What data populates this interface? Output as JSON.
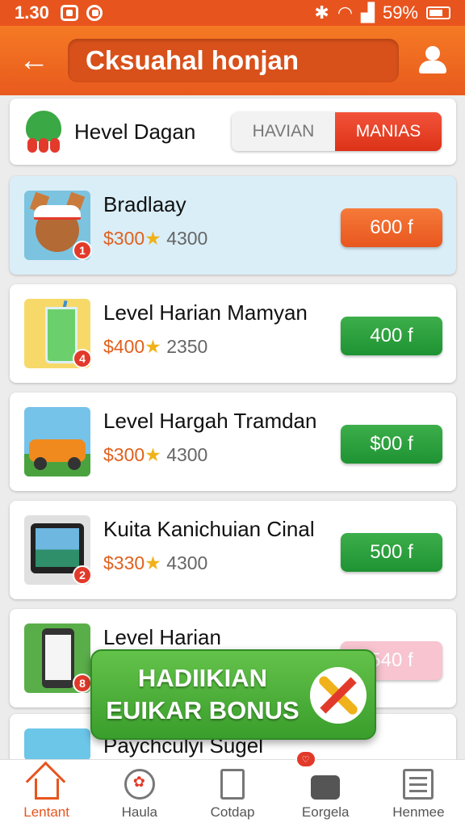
{
  "status_bar": {
    "time": "1.30",
    "battery": "59%"
  },
  "header": {
    "title": "Cksuahal honjan"
  },
  "filter": {
    "title": "Hevel Dagan",
    "tabs": [
      {
        "label": "HAVIAN",
        "active": false
      },
      {
        "label": "MANIAS",
        "active": true
      }
    ]
  },
  "items": [
    {
      "title": "Bradlaay",
      "price": "$300",
      "star": "★",
      "count": "4300",
      "button": "600 f",
      "badge": "1"
    },
    {
      "title": "Level Harian Mamyan",
      "price": "$400",
      "star": "★",
      "count": "2350",
      "button": "400 f",
      "badge": "4"
    },
    {
      "title": "Level Hargah Tramdan",
      "price": "$300",
      "star": "★",
      "count": "4300",
      "button": "$00 f",
      "badge": ""
    },
    {
      "title": "Kuita Kanichuian Cinal",
      "price": "$330",
      "star": "★",
      "count": "4300",
      "button": "500 f",
      "badge": "2"
    },
    {
      "title": "Level Harian",
      "price": "",
      "star": "",
      "count": "",
      "button": "540 f",
      "badge": "8"
    },
    {
      "title": "Paychculyi Sugel",
      "price": "",
      "star": "",
      "count": "",
      "button": "",
      "badge": ""
    }
  ],
  "bonus": {
    "line1": "HADIIKIAN",
    "line2": "EUIKAR BONUS"
  },
  "bottom_nav": [
    {
      "label": "Lentant",
      "icon": "home-icon",
      "active": true
    },
    {
      "label": "Haula",
      "icon": "flower-circle-icon",
      "active": false
    },
    {
      "label": "Cotdap",
      "icon": "document-icon",
      "active": false
    },
    {
      "label": "Eorgela",
      "icon": "bag-icon",
      "active": false,
      "badge": ""
    },
    {
      "label": "Henmee",
      "icon": "list-icon",
      "active": false
    }
  ],
  "colors": {
    "accent": "#e8541e",
    "green": "#2a9c3a",
    "highlight": "#daeef8"
  }
}
